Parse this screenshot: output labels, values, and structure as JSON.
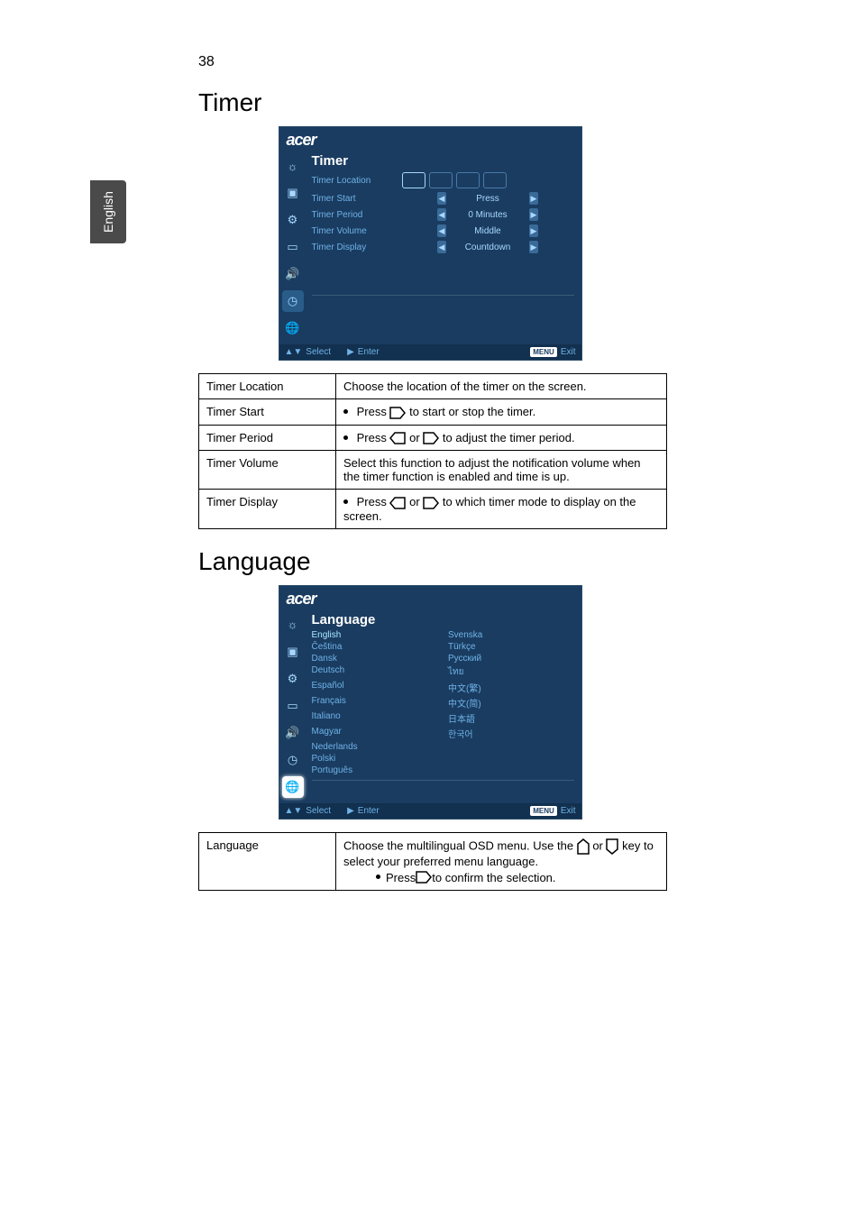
{
  "page_number": "38",
  "side_tab": "English",
  "sections": {
    "timer": {
      "title": "Timer",
      "osd": {
        "logo": "acer",
        "heading": "Timer",
        "rows": {
          "location": {
            "label": "Timer Location"
          },
          "start": {
            "label": "Timer Start",
            "value": "Press"
          },
          "period": {
            "label": "Timer Period",
            "value": "0   Minutes"
          },
          "volume": {
            "label": "Timer Volume",
            "value": "Middle"
          },
          "display": {
            "label": "Timer Display",
            "value": "Countdown"
          }
        },
        "footer": {
          "select": "Select",
          "enter": "Enter",
          "menu": "MENU",
          "exit": "Exit"
        }
      },
      "table": {
        "r1": {
          "label": "Timer Location",
          "desc": "Choose the location of the timer on the screen."
        },
        "r2": {
          "label": "Timer Start",
          "pre": "Press ",
          "post": " to start or stop the timer."
        },
        "r3": {
          "label": "Timer Period",
          "pre": "Press ",
          "mid": " or ",
          "post": " to adjust the timer period."
        },
        "r4": {
          "label": "Timer Volume",
          "desc": "Select this function to adjust the notification volume when the timer function is enabled and time is up."
        },
        "r5": {
          "label": "Timer Display",
          "pre": "Press ",
          "mid": " or ",
          "post": " to which timer mode to display on the screen."
        }
      }
    },
    "language": {
      "title": "Language",
      "osd": {
        "logo": "acer",
        "heading": "Language",
        "langs": {
          "c0r0": "English",
          "c1r0": "Svenska",
          "c0r1": "Čeština",
          "c1r1": "Türkçe",
          "c0r2": "Dansk",
          "c1r2": "Русский",
          "c0r3": "Deutsch",
          "c1r3": "ไทย",
          "c0r4": "Español",
          "c1r4": "中文(繁)",
          "c0r5": "Français",
          "c1r5": "中文(简)",
          "c0r6": "Italiano",
          "c1r6": "日本語",
          "c0r7": "Magyar",
          "c1r7": "한국어",
          "c0r8": "Nederlands",
          "c1r8": "",
          "c0r9": "Polski",
          "c1r9": "",
          "c0r10": "Português",
          "c1r10": ""
        },
        "footer": {
          "select": "Select",
          "enter": "Enter",
          "menu": "MENU",
          "exit": "Exit"
        }
      },
      "table": {
        "r1": {
          "label": "Language",
          "pre": "Choose the multilingual OSD menu. Use the ",
          "mid": " or ",
          "post": " key to select your preferred menu language.",
          "bullet_pre": "Press ",
          "bullet_post": " to confirm the selection."
        }
      }
    }
  }
}
